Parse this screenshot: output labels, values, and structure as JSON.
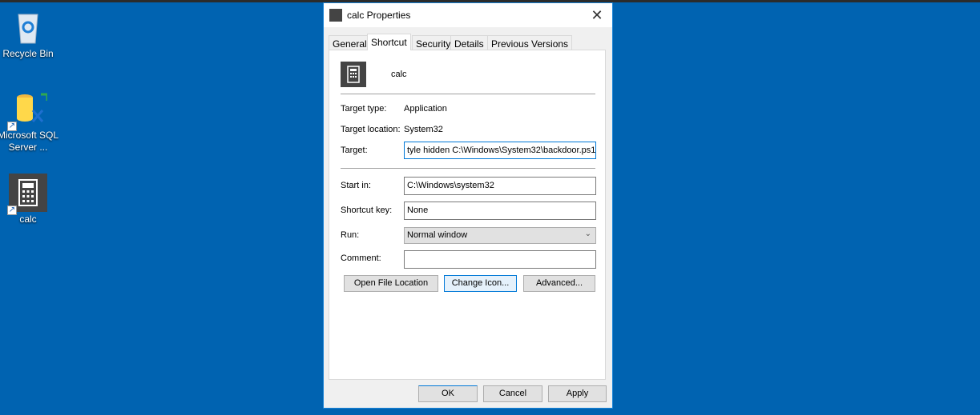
{
  "desktop": {
    "icons": [
      {
        "label": "Recycle Bin",
        "icon": "recycle-bin-icon"
      },
      {
        "label": "Microsoft SQL Server ...",
        "icon": "sql-server-icon"
      },
      {
        "label": "calc",
        "icon": "calculator-icon"
      }
    ]
  },
  "dialog": {
    "title": "calc Properties",
    "tabs": [
      "General",
      "Shortcut",
      "Security",
      "Details",
      "Previous Versions"
    ],
    "active_tab": "Shortcut",
    "name": "calc",
    "target_type_label": "Target type:",
    "target_type": "Application",
    "target_location_label": "Target location:",
    "target_location": "System32",
    "target_label": "Target:",
    "target": "tyle hidden C:\\Windows\\System32\\backdoor.ps1",
    "start_in_label": "Start in:",
    "start_in": "C:\\Windows\\system32",
    "shortcut_key_label": "Shortcut key:",
    "shortcut_key": "None",
    "run_label": "Run:",
    "run": "Normal window",
    "comment_label": "Comment:",
    "comment": "",
    "buttons": {
      "open_file_location": "Open File Location",
      "change_icon": "Change Icon...",
      "advanced": "Advanced...",
      "ok": "OK",
      "cancel": "Cancel",
      "apply": "Apply"
    }
  }
}
